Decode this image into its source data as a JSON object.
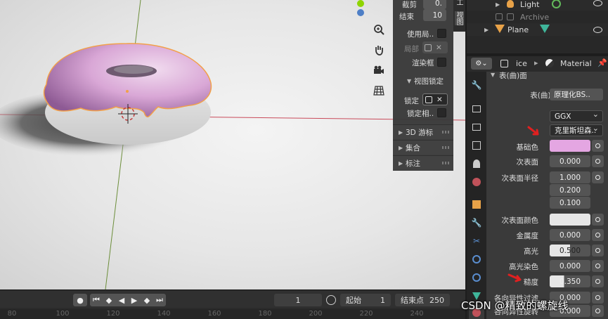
{
  "colors": {
    "base_color": "#e4a6e2",
    "selection_outline": "#f2a04a",
    "x_axis": "#c94a5a",
    "y_axis": "#6c8e3a",
    "gizmo_green": "#8fd400",
    "gizmo_blue": "#4e7fc6"
  },
  "npanel": {
    "clip_end_label": "截剪",
    "clip_end_value": "0.",
    "end_label": "结束",
    "end_value": "10",
    "use_local_label": "使用局..",
    "local_label": "局部",
    "render_region_label": "渲染框",
    "view_lock_title": "视图锁定",
    "lock_label": "锁定",
    "lock_to_label": "锁定相..",
    "cursor_section": "3D 游标",
    "collection_section": "集合",
    "annotation_section": "标注",
    "tab_view": "视图",
    "tab_tool": "工"
  },
  "timeline": {
    "current_frame": "1",
    "start_label": "起始",
    "start_value": "1",
    "end_label": "结束点",
    "end_value": "250",
    "ruler": [
      "80",
      "100",
      "120",
      "140",
      "160",
      "180",
      "200",
      "220",
      "240"
    ]
  },
  "outliner": {
    "items": [
      {
        "label": "Light"
      },
      {
        "label": "Archive"
      },
      {
        "label": "Plane"
      }
    ]
  },
  "properties": {
    "breadcrumb_object": "ice",
    "breadcrumb_material": "Material",
    "panel_title": "表(曲)面",
    "surface_label": "表(曲)面",
    "surface_value": "原理化BS..",
    "distribution": "GGX",
    "subsurface_method": "克里斯坦森..",
    "base_color_label": "基础色",
    "subsurface_label": "次表面",
    "subsurface_value": "0.000",
    "subsurface_radius_label": "次表面半径",
    "radius_1": "1.000",
    "radius_2": "0.200",
    "radius_3": "0.100",
    "subsurface_color_label": "次表面颜色",
    "metallic_label": "金属度",
    "metallic_value": "0.000",
    "specular_label": "高光",
    "specular_value": "0.500",
    "specular_tint_label": "高光染色",
    "specular_tint_value": "0.000",
    "roughness_label": "糙度",
    "roughness_value": "0.350",
    "anisotropic_label": "各向异性过滤",
    "anisotropic_value": "0.000",
    "anisotropic_rotation_label": "各向异性旋转",
    "anisotropic_rotation_value": "0.000"
  },
  "watermark": "CSDN @精致的螺旋线"
}
